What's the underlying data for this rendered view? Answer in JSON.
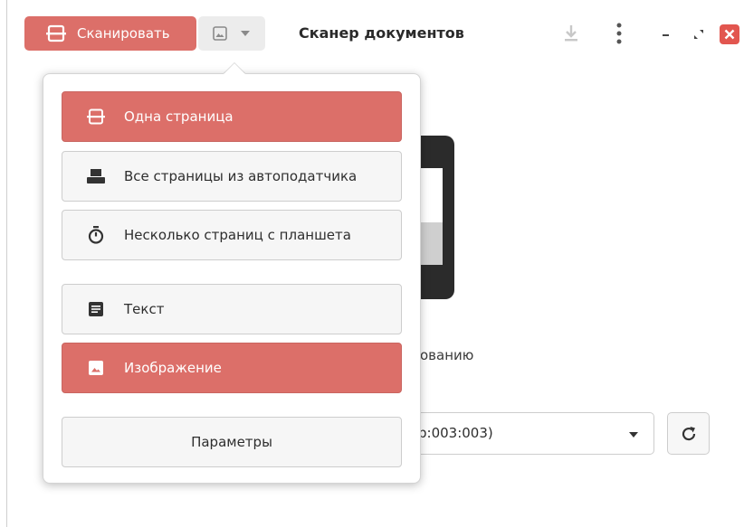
{
  "header": {
    "scan_label": "Сканировать",
    "title": "Сканер документов"
  },
  "background": {
    "partial_text": "ованию",
    "device_value": "b:003:003)"
  },
  "menu": {
    "items": [
      {
        "label": "Одна страница",
        "icon": "single-page-scan-icon",
        "selected": true
      },
      {
        "label": "Все страницы из автоподатчика",
        "icon": "feeder-icon",
        "selected": false
      },
      {
        "label": "Несколько страниц с планшета",
        "icon": "timer-icon",
        "selected": false
      }
    ],
    "types": [
      {
        "label": "Текст",
        "icon": "text-document-icon",
        "selected": false
      },
      {
        "label": "Изображение",
        "icon": "image-icon",
        "selected": true
      }
    ],
    "preferences_label": "Параметры"
  },
  "colors": {
    "accent": "#dc6f69",
    "close": "#e2564f"
  }
}
